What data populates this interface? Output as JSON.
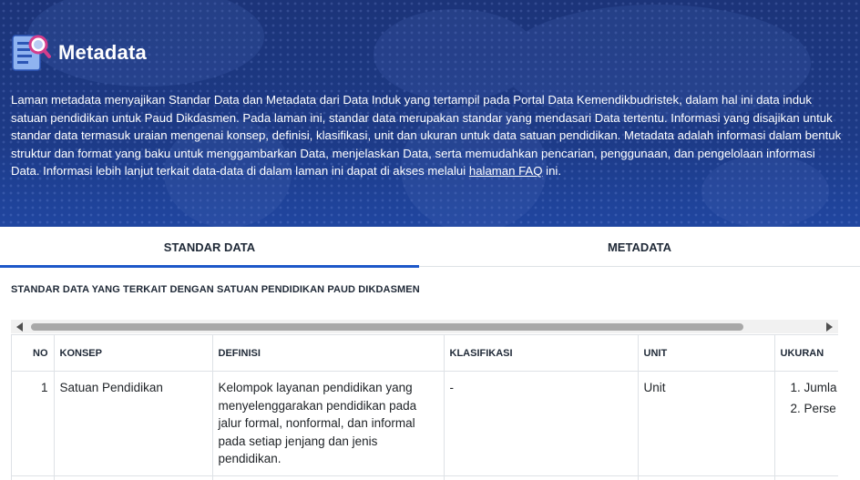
{
  "header": {
    "title": "Metadata",
    "intro_text": "Laman metadata menyajikan Standar Data dan Metadata dari Data Induk yang tertampil pada Portal Data Kemendikbudristek, dalam hal ini data induk satuan pendidikan untuk Paud Dikdasmen. Pada laman ini, standar data merupakan standar yang mendasari Data tertentu. Informasi yang disajikan untuk standar data termasuk uraian mengenai konsep, definisi, klasifikasi, unit dan ukuran untuk data satuan pendidikan. Metadata adalah informasi dalam bentuk struktur dan format yang baku untuk menggambarkan Data, menjelaskan Data, serta memudahkan pencarian, penggunaan, dan pengelolaan informasi Data. Informasi lebih lanjut terkait data-data di dalam laman ini dapat di akses melalui ",
    "faq_link": "halaman FAQ",
    "intro_tail": " ini."
  },
  "tabs": [
    {
      "label": "STANDAR DATA",
      "active": true
    },
    {
      "label": "METADATA",
      "active": false
    }
  ],
  "section_label": "STANDAR DATA YANG TERKAIT DENGAN SATUAN PENDIDIKAN PAUD DIKDASMEN",
  "table": {
    "headers": {
      "no": "NO",
      "konsep": "KONSEP",
      "definisi": "DEFINISI",
      "klasifikasi": "KLASIFIKASI",
      "unit": "UNIT",
      "ukuran": "UKURAN"
    },
    "rows": [
      {
        "no": "1",
        "konsep": "Satuan Pendidikan",
        "definisi": "Kelompok layanan pendidikan yang menyelenggarakan pendidikan pada jalur formal, nonformal, dan informal pada setiap jenjang dan jenis pendidikan.",
        "klasifikasi": "-",
        "unit": "Unit",
        "ukuran": [
          "Jumla",
          "Perse"
        ]
      }
    ]
  },
  "colors": {
    "header_bg": "#1c3479",
    "tab_active_underline": "#1d58c9"
  }
}
